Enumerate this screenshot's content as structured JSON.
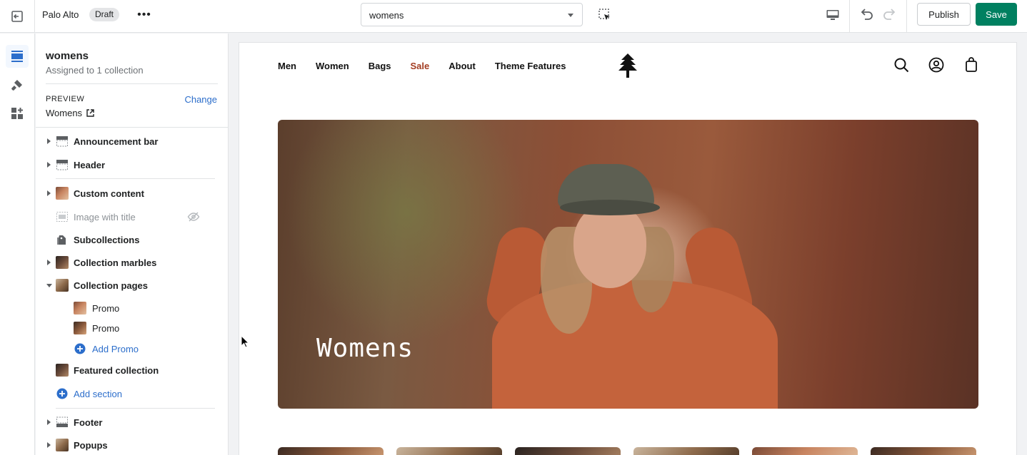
{
  "topbar": {
    "store_name": "Palo Alto",
    "status_badge": "Draft",
    "more_label": "•••",
    "template_select": {
      "value": "womens"
    },
    "publish_label": "Publish",
    "save_label": "Save"
  },
  "sidebar": {
    "title": "womens",
    "subtitle": "Assigned to 1 collection",
    "preview": {
      "label": "PREVIEW",
      "change_label": "Change",
      "value": "Womens"
    },
    "sections": [
      {
        "label": "Announcement bar"
      },
      {
        "label": "Header"
      },
      {
        "label": "Custom content"
      },
      {
        "label": "Image with title",
        "hidden": true
      },
      {
        "label": "Subcollections"
      },
      {
        "label": "Collection marbles"
      },
      {
        "label": "Collection pages",
        "expanded": true
      },
      {
        "label": "Promo"
      },
      {
        "label": "Promo"
      },
      {
        "label": "Add Promo"
      },
      {
        "label": "Featured collection"
      },
      {
        "label": "Add section"
      },
      {
        "label": "Footer"
      },
      {
        "label": "Popups"
      }
    ]
  },
  "preview_site": {
    "nav": [
      "Men",
      "Women",
      "Bags",
      "Sale",
      "About",
      "Theme Features"
    ],
    "hero_title": "Womens"
  },
  "colors": {
    "primary_green": "#008060",
    "link_blue": "#2c6ecb",
    "sale_red": "#a33d22"
  }
}
